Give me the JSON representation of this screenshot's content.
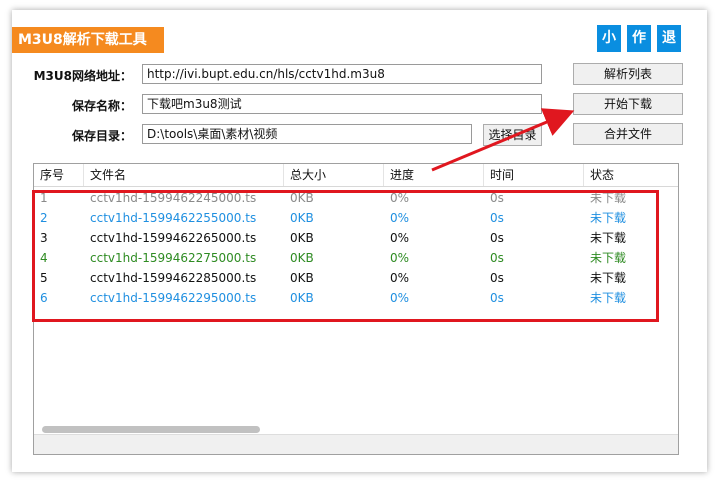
{
  "app": {
    "title": "M3U8解析下载工具"
  },
  "top_buttons": [
    {
      "label": "小"
    },
    {
      "label": "作"
    },
    {
      "label": "退"
    }
  ],
  "form": {
    "url_label": "M3U8网络地址：",
    "url_value": "http://ivi.bupt.edu.cn/hls/cctv1hd.m3u8",
    "name_label": "保存名称：",
    "name_value": "下载吧m3u8测试",
    "dir_label": "保存目录：",
    "dir_value": "D:\\tools\\桌面\\素材\\视频",
    "choose_dir_label": "选择目录"
  },
  "side_buttons": {
    "parse_label": "解析列表",
    "start_label": "开始下载",
    "merge_label": "合并文件"
  },
  "table": {
    "headers": [
      "序号",
      "文件名",
      "总大小",
      "进度",
      "时间",
      "状态"
    ],
    "rows": [
      {
        "cells": [
          "1",
          "cctv1hd-1599462245000.ts",
          "0KB",
          "0%",
          "0s",
          "未下载"
        ],
        "color": "#8a8a8a"
      },
      {
        "cells": [
          "2",
          "cctv1hd-1599462255000.ts",
          "0KB",
          "0%",
          "0s",
          "未下载"
        ],
        "color": "#1f8fe0"
      },
      {
        "cells": [
          "3",
          "cctv1hd-1599462265000.ts",
          "0KB",
          "0%",
          "0s",
          "未下载"
        ],
        "color": "#111111"
      },
      {
        "cells": [
          "4",
          "cctv1hd-1599462275000.ts",
          "0KB",
          "0%",
          "0s",
          "未下载"
        ],
        "color": "#2e8b22"
      },
      {
        "cells": [
          "5",
          "cctv1hd-1599462285000.ts",
          "0KB",
          "0%",
          "0s",
          "未下载"
        ],
        "color": "#111111"
      },
      {
        "cells": [
          "6",
          "cctv1hd-1599462295000.ts",
          "0KB",
          "0%",
          "0s",
          "未下载"
        ],
        "color": "#1f8fe0"
      }
    ]
  },
  "colors": {
    "accent": "#f58a1f",
    "button_blue": "#0a8ee0",
    "annotation_red": "#e0171f"
  }
}
